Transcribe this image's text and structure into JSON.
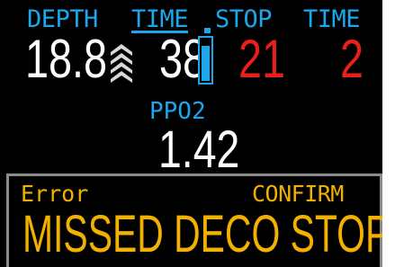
{
  "header": {
    "depth_label": "DEPTH",
    "time_label": "TIME",
    "stop_label": "STOP",
    "stop_time_label": "TIME"
  },
  "readings": {
    "depth": "18.8",
    "dive_time": "38",
    "stop_depth": "21",
    "stop_time": "2"
  },
  "ascent_indicator": {
    "icon": "ascent-rate-chevrons",
    "color": "#d9d9d9"
  },
  "battery": {
    "icon": "battery-icon",
    "level": 0.85,
    "color": "#1aa7ee"
  },
  "ppo2": {
    "label": "PPO2",
    "value": "1.42"
  },
  "alert": {
    "type": "Error",
    "action": "CONFIRM",
    "message": "MISSED DECO STOP"
  },
  "colors": {
    "label": "#1aa7ee",
    "value": "#ffffff",
    "warning": "#e8201c",
    "alert": "#f2b000",
    "alert_border": "#8c8c8c"
  }
}
